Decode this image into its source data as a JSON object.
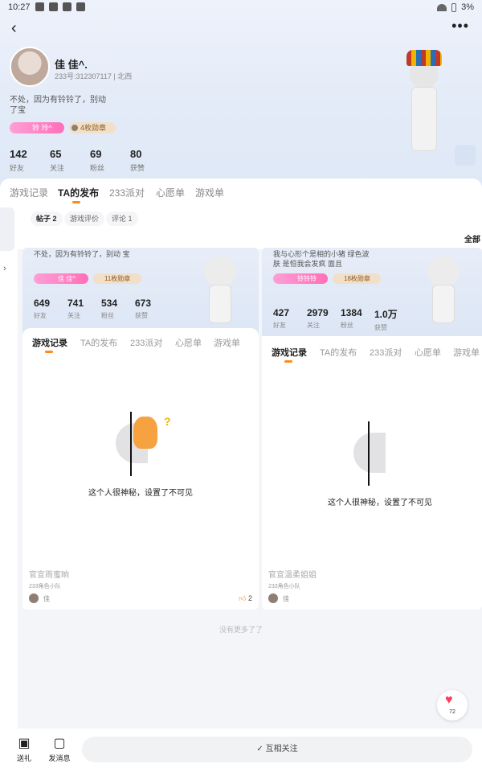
{
  "status_bar": {
    "time": "10:27",
    "battery": "3%"
  },
  "header": {
    "back_icon": "back-icon",
    "more_icon": "more-icon"
  },
  "profile": {
    "name": "佳 佳^.",
    "id_line": "233号:312307117 | 北西",
    "bio": "不处，因为有铃铃了，别动 了宝",
    "badge_name": "铃 玲^",
    "badge_collect": "4枚勋章",
    "stats": [
      {
        "value": "142",
        "label": "好友"
      },
      {
        "value": "65",
        "label": "关注"
      },
      {
        "value": "69",
        "label": "粉丝"
      },
      {
        "value": "80",
        "label": "获赞"
      }
    ]
  },
  "main_tabs": [
    "游戏记录",
    "TA的发布",
    "233派对",
    "心愿单",
    "游戏单"
  ],
  "main_tab_active": 1,
  "sub_tabs": [
    "帖子 2",
    "游戏评价",
    "评论 1"
  ],
  "all_label": "全部",
  "cards": [
    {
      "bio": "不处，因为有铃铃了，别动 宝",
      "badge_name": "佳 佳^",
      "badge_collect": "11枚勋章",
      "stats": [
        {
          "value": "649",
          "label": "好友"
        },
        {
          "value": "741",
          "label": "关注"
        },
        {
          "value": "534",
          "label": "粉丝"
        },
        {
          "value": "673",
          "label": "获赞"
        }
      ],
      "tabs": [
        "游戏记录",
        "TA的发布",
        "233派对",
        "心愿单",
        "游戏单"
      ],
      "empty_text": "这个人很神秘，设置了不可见",
      "footer_title": "官宣雨蜜晌",
      "footer_sub": "233角色小队",
      "author_name": "佳",
      "likes": "2"
    },
    {
      "bio": "我与心形个是相的小猪 绿色波肤 是恒我会发疯 面且",
      "badge_name": "铃铃铃",
      "badge_collect": "18枚勋章",
      "stats": [
        {
          "value": "427",
          "label": "好友"
        },
        {
          "value": "2979",
          "label": "关注"
        },
        {
          "value": "1384",
          "label": "粉丝"
        },
        {
          "value": "1.0万",
          "label": "获赞"
        }
      ],
      "tabs": [
        "游戏记录",
        "TA的发布",
        "233派对",
        "心愿单",
        "游戏单"
      ],
      "empty_text": "这个人很神秘，设置了不可见",
      "footer_title": "官宣温柔姐姐",
      "footer_sub": "233角色小队",
      "author_name": "佳",
      "likes": ""
    }
  ],
  "end_text": "没有更多了了",
  "float_like": {
    "icon": "heart-icon",
    "count": "72"
  },
  "bottom_bar": {
    "items": [
      {
        "label": "送礼",
        "icon": "gift-icon"
      },
      {
        "label": "发消息",
        "icon": "chat-icon"
      }
    ],
    "follow_label": "✓ 互相关注"
  }
}
